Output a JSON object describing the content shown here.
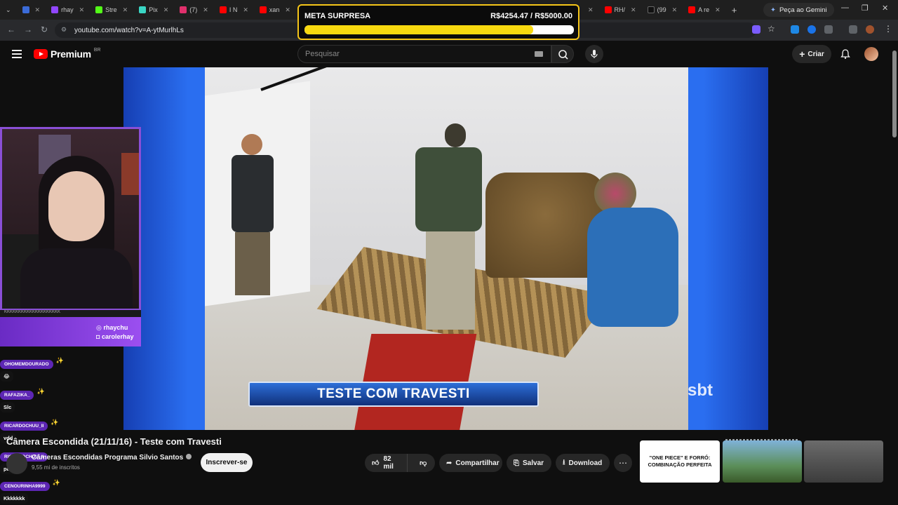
{
  "browser": {
    "tabs": [
      {
        "label": "",
        "color": "#3b6bd8"
      },
      {
        "label": "",
        "color": "#1f8bff"
      },
      {
        "label": "rhay",
        "color": "#9146ff"
      },
      {
        "label": "Stre",
        "color": "#53fc18"
      },
      {
        "label": "Pix",
        "color": "#3ad6c4"
      },
      {
        "label": "(7)",
        "color": "#e1306c"
      },
      {
        "label": "I N",
        "color": "#ff0000"
      },
      {
        "label": "xan",
        "color": "#ff0000"
      },
      {
        "label": "RH/",
        "color": "#ff0000"
      },
      {
        "label": "(99",
        "color": "#111111"
      },
      {
        "label": "A re",
        "color": "#ff0000"
      }
    ],
    "new_tab_label": "+",
    "gemini_label": "Peça ao Gemini",
    "url": "youtube.com/watch?v=A-ytMurlhLs"
  },
  "goal": {
    "title": "META SURPRESA",
    "amount": "R$4254.47 / R$5000.00",
    "progress": 0.85,
    "fill_color": "#f8d90f",
    "border_color": "#f5c518"
  },
  "youtube": {
    "brand": "Premium",
    "region": "BR",
    "search_placeholder": "Pesquisar",
    "create_label": "Criar"
  },
  "video": {
    "lower_third": "TESTE COM TRAVESTI",
    "network_logo": "sbt",
    "title": "Câmera Escondida (21/11/16) - Teste com Travesti",
    "channel": "Câmeras Escondidas Programa Silvio Santos",
    "subscribers": "9,55 mi de inscritos",
    "subscribe_label": "Inscrever-se",
    "likes": "82 mil",
    "share_label": "Compartilhar",
    "save_label": "Salvar",
    "download_label": "Download",
    "more_label": "⋯"
  },
  "stream_overlay": {
    "social_1": "rhaychu",
    "social_2": "carolerhay",
    "ticker": "KKKKKKKKKKKKKKKKKKKK"
  },
  "chat": [
    {
      "name": "OHOMEMDOURADO",
      "text": "😂"
    },
    {
      "name": "RAFAZIKA_",
      "text": "Slc"
    },
    {
      "name": "RICARDOCHUU_II",
      "text": "vdd"
    },
    {
      "name": "RICARDOCHUU_II",
      "text": "parece"
    },
    {
      "name": "CENOURINHA9999",
      "text": "Kkkkkkk"
    }
  ],
  "recommendations": {
    "thumb1_text": "\"ONE PIECE\" E FORRÓ: COMBINAÇÃO PERFEITA"
  }
}
